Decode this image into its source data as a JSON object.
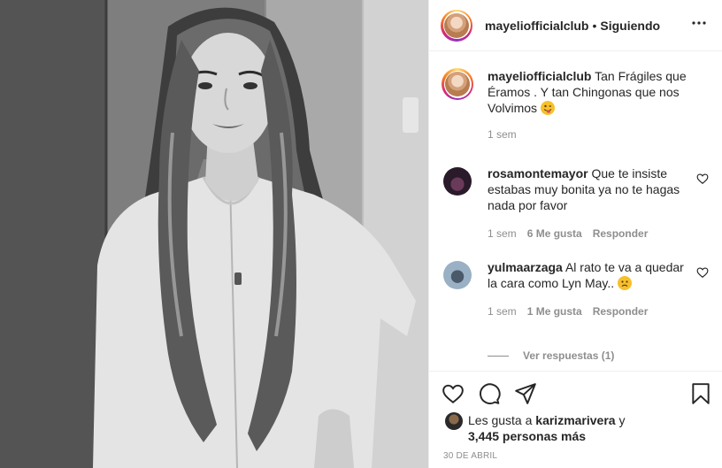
{
  "post": {
    "username": "mayeliofficialclub",
    "separator": "•",
    "follow_status": "Siguiendo",
    "more_icon": "more-horizontal-icon",
    "photo_alt": "mayeliofficialclub photo"
  },
  "caption": {
    "username": "mayeliofficialclub",
    "text": "Tan Frágiles que Éramos . Y tan Chingonas que nos Volvimos",
    "emoji": "winking-tongue-emoji",
    "time": "1 sem"
  },
  "comments": [
    {
      "username": "rosamontemayor",
      "text": "Que te insiste estabas muy bonita ya no te hagas nada por favor",
      "time": "1 sem",
      "likes": "6 Me gusta",
      "reply_label": "Responder"
    },
    {
      "username": "yulmaarzaga",
      "text": "Al rato te va a quedar la cara como Lyn May..",
      "emoji": "disappointed-face-emoji",
      "time": "1 sem",
      "likes": "1 Me gusta",
      "reply_label": "Responder",
      "view_replies": "Ver respuestas (1)"
    }
  ],
  "actions": {
    "like_icon": "heart-icon",
    "comment_icon": "comment-icon",
    "share_icon": "paper-plane-icon",
    "save_icon": "bookmark-icon"
  },
  "likes": {
    "prefix": "Les gusta a",
    "user": "karizmarivera",
    "connector": "y",
    "others": "3,445 personas más"
  },
  "date": "30 DE ABRIL",
  "colors": {
    "text": "#262626",
    "secondary": "#8e8e8e",
    "divider": "#efefef",
    "story_ring": [
      "#feda75",
      "#fa7e1e",
      "#d62976",
      "#962fbf"
    ],
    "emoji_yellow": "#f7c02b"
  }
}
